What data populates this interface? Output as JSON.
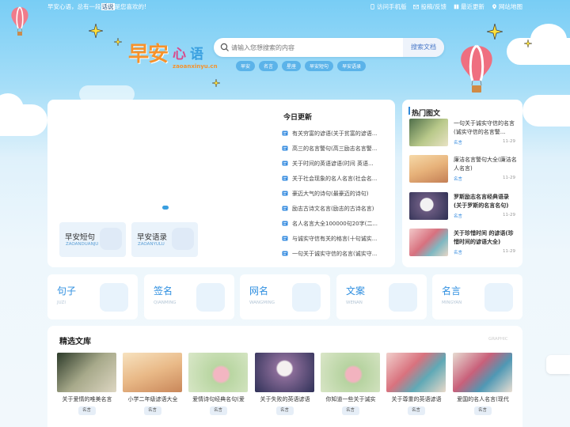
{
  "topbar": {
    "notice_before": "早安心语，总有一段",
    "notice_highlight": "话说",
    "notice_after": "是您喜欢的!",
    "links": [
      {
        "label": "访问手机版",
        "icon": "mobile-icon"
      },
      {
        "label": "投稿/反馈",
        "icon": "mail-icon"
      },
      {
        "label": "最近更新",
        "icon": "book-icon"
      },
      {
        "label": "网站地图",
        "icon": "location-icon"
      }
    ]
  },
  "logo": {
    "text_main": "早安",
    "text_pink": "心",
    "text_blue": "语",
    "domain": "zaoanxinyu.cn"
  },
  "search": {
    "placeholder": "请输入您想搜索的内容",
    "button": "搜索文档",
    "tags": [
      "早安",
      "名言",
      "星座",
      "早安短句",
      "早安语录"
    ]
  },
  "carousel": {
    "cards": [
      {
        "title": "早安短句",
        "en": "ZAOANDUANJU"
      },
      {
        "title": "早安语录",
        "en": "ZAOANYULU"
      }
    ]
  },
  "today": {
    "title": "今日更新",
    "items": [
      "有关穷富的谚语(关于贫富的谚语...",
      "高三的名言警句(高三励志名言警...",
      "关于时间的英语谚语(时间 英语...",
      "关于社会现象的名人名言(社会名...",
      "豪迈大气的诗句(最豪迈的诗句)",
      "励志古诗文名言(励志的古诗名言)",
      "名人名言大全100000句20字(二...",
      "与诚实守信有关的格言(十句诚实...",
      "一句关于诚实守信的名言(诚实守..."
    ]
  },
  "hot": {
    "title": "热门图文",
    "items": [
      {
        "title": "一句关于诚实守信的名言(诚实守信的名言警...",
        "cat": "名言",
        "date": "11-29",
        "bold": false
      },
      {
        "title": "廉洁名言警句大全(廉洁名人名言)",
        "cat": "名言",
        "date": "11-29",
        "bold": false
      },
      {
        "title": "罗斯励志名言经典语录(关于罗斯的名言名句)",
        "cat": "名言",
        "date": "11-29",
        "bold": true
      },
      {
        "title": "关于珍惜时间 的谚语(珍惜时间的谚语大全)",
        "cat": "名言",
        "date": "11-29",
        "bold": true
      }
    ]
  },
  "categories": [
    {
      "title": "句子",
      "en": "JUZI"
    },
    {
      "title": "签名",
      "en": "QIANMING"
    },
    {
      "title": "网名",
      "en": "WANGMING"
    },
    {
      "title": "文案",
      "en": "WENAN"
    },
    {
      "title": "名言",
      "en": "MINGYAN"
    }
  ],
  "library": {
    "title": "精选文库",
    "en": "GRAPHIC",
    "items": [
      {
        "title": "关于爱情的唯美名言",
        "tag": "名言"
      },
      {
        "title": "小学二年级谚语大全",
        "tag": "名言"
      },
      {
        "title": "爱情诗句经典名句(爱",
        "tag": "名言"
      },
      {
        "title": "关于失败的英语谚语",
        "tag": "名言"
      },
      {
        "title": "你知道一些关于诚实",
        "tag": "名言"
      },
      {
        "title": "关于尊重的英语谚语",
        "tag": "名言"
      },
      {
        "title": "爱国的名人名言(现代",
        "tag": "名言"
      }
    ]
  },
  "colors": {
    "accent": "#2f8fe0",
    "logo_orange": "#f6922b",
    "logo_green": "#7abf2a",
    "tag_blue": "#5bb3e9"
  }
}
